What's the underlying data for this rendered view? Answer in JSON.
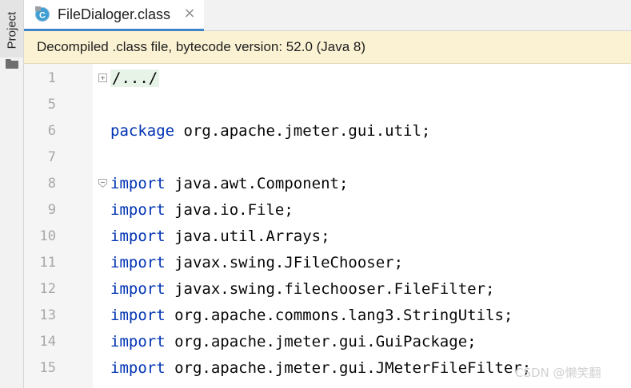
{
  "toolstrip": {
    "project_label": "Project"
  },
  "tab": {
    "title": "FileDialoger.class",
    "close_glyph": "×",
    "icon_letter": "C"
  },
  "banner": {
    "text": "Decompiled .class file, bytecode version: 52.0 (Java 8)"
  },
  "editor": {
    "lines": [
      {
        "num": "1",
        "keyword": "",
        "rest": "/.../"
      },
      {
        "num": "5",
        "keyword": "",
        "rest": ""
      },
      {
        "num": "6",
        "keyword": "package",
        "rest": " org.apache.jmeter.gui.util;"
      },
      {
        "num": "7",
        "keyword": "",
        "rest": ""
      },
      {
        "num": "8",
        "keyword": "import",
        "rest": " java.awt.Component;"
      },
      {
        "num": "9",
        "keyword": "import",
        "rest": " java.io.File;"
      },
      {
        "num": "10",
        "keyword": "import",
        "rest": " java.util.Arrays;"
      },
      {
        "num": "11",
        "keyword": "import",
        "rest": " javax.swing.JFileChooser;"
      },
      {
        "num": "12",
        "keyword": "import",
        "rest": " javax.swing.filechooser.FileFilter;"
      },
      {
        "num": "13",
        "keyword": "import",
        "rest": " org.apache.commons.lang3.StringUtils;"
      },
      {
        "num": "14",
        "keyword": "import",
        "rest": " org.apache.jmeter.gui.GuiPackage;"
      },
      {
        "num": "15",
        "keyword": "import",
        "rest": " org.apache.jmeter.gui.JMeterFileFilter;"
      }
    ]
  },
  "watermark": "CSDN @懒笑翻",
  "colors": {
    "keyword": "#0033b3",
    "banner_bg": "#fbf2d3",
    "tab_underline": "#4083c9",
    "class_icon": "#3f9fd4"
  },
  "icons": {
    "tool_window": "folder-icon",
    "tab": "class-file-icon",
    "close": "close-icon",
    "fold_expand": "fold-expand-icon",
    "fold_collapse": "fold-collapse-icon"
  }
}
